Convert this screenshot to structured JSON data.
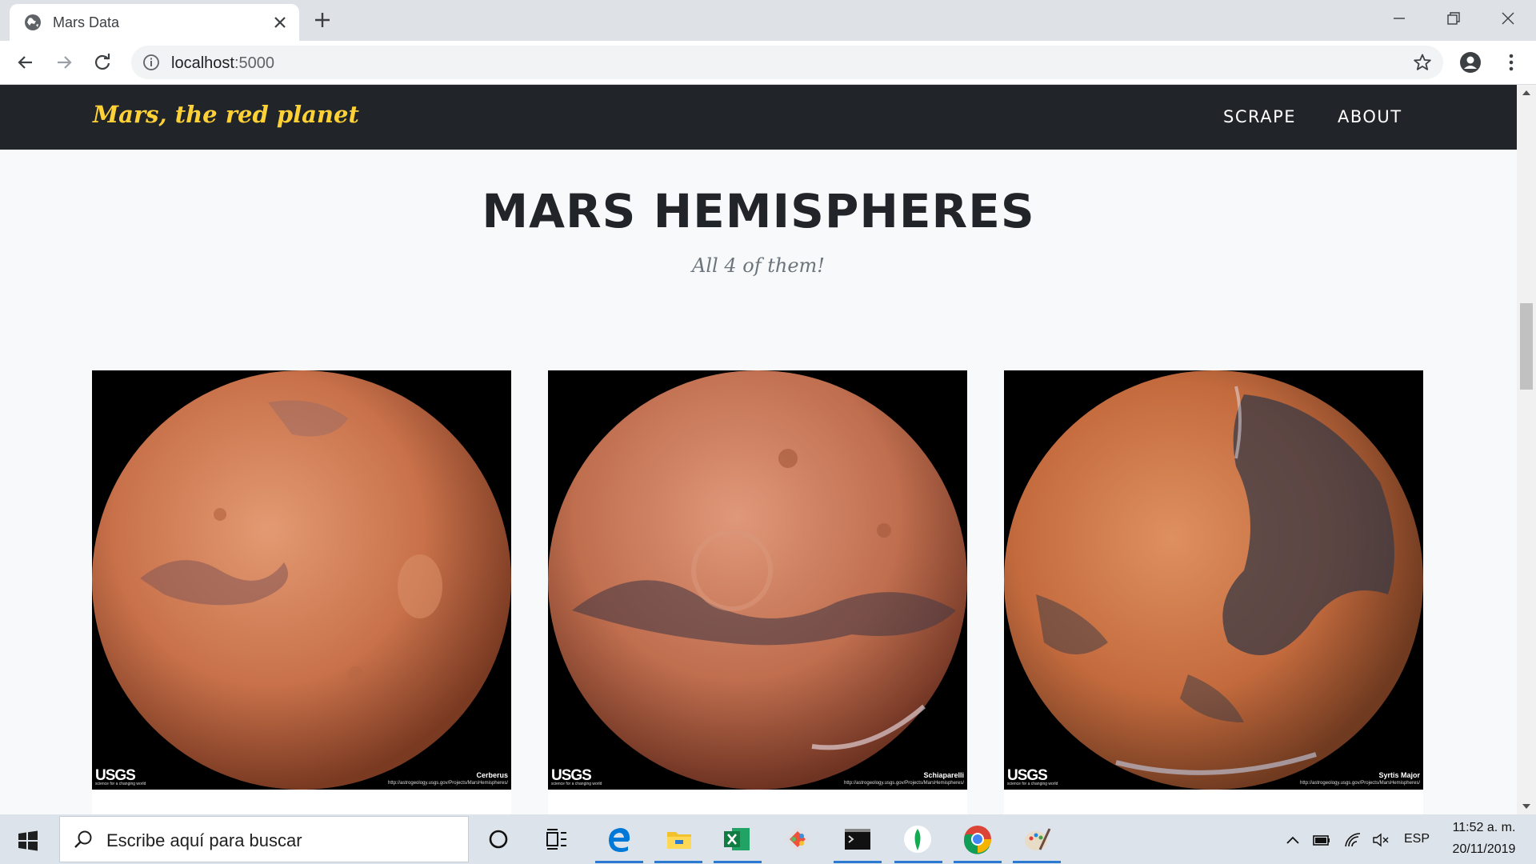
{
  "browser": {
    "tab_title": "Mars Data",
    "url_host": "localhost",
    "url_port": ":5000"
  },
  "site": {
    "brand": "Mars, the red planet",
    "nav": [
      "SCRAPE",
      "ABOUT"
    ],
    "heading": "MARS HEMISPHERES",
    "subheading": "All 4 of them!"
  },
  "hemispheres": [
    {
      "caption": "Cerberus",
      "logo": "USGS",
      "logo_tag": "science for a changing world",
      "url": "http://astrogeology.usgs.gov/Projects/MarsHemispheres/"
    },
    {
      "caption": "Schiaparelli",
      "logo": "USGS",
      "logo_tag": "science for a changing world",
      "url": "http://astrogeology.usgs.gov/Projects/MarsHemispheres/"
    },
    {
      "caption": "Syrtis Major",
      "logo": "USGS",
      "logo_tag": "science for a changing world",
      "url": "http://astrogeology.usgs.gov/Projects/MarsHemispheres/"
    }
  ],
  "taskbar": {
    "search_placeholder": "Escribe aquí para buscar",
    "language": "ESP",
    "time": "11:52 a. m.",
    "date": "20/11/2019",
    "pinned_icons": [
      "cortana-icon",
      "task-view-icon",
      "edge-icon",
      "file-explorer-icon",
      "excel-icon",
      "git-icon",
      "terminal-icon",
      "mongodb-icon",
      "chrome-icon",
      "paint-icon"
    ]
  },
  "colors": {
    "navbar_bg": "#212529",
    "brand": "#fed136",
    "page_bg": "#f8f9fa",
    "mars": "#c8714a"
  }
}
